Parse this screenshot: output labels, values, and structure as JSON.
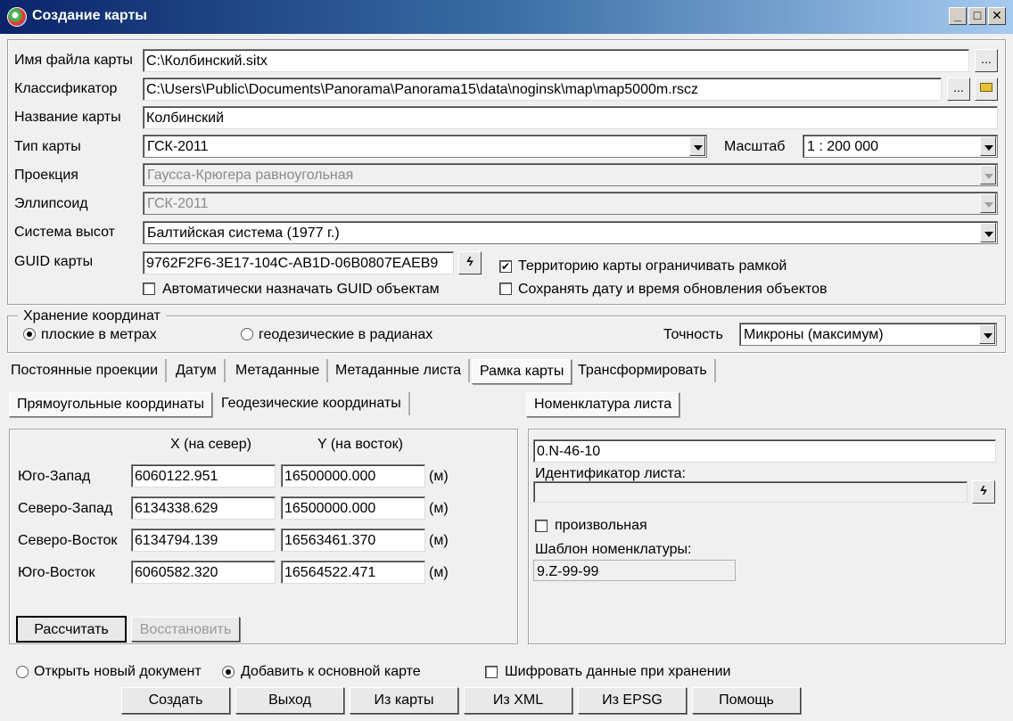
{
  "window": {
    "title": "Создание карты",
    "buttons": [
      "_",
      "□",
      "✕"
    ]
  },
  "form": {
    "file_label": "Имя файла карты",
    "file_value": "C:\\Колбинский.sitx",
    "classifier_label": "Классификатор",
    "classifier_value": "C:\\Users\\Public\\Documents\\Panorama\\Panorama15\\data\\noginsk\\map\\map5000m.rscz",
    "name_label": "Название карты",
    "name_value": "Колбинский",
    "type_label": "Тип карты",
    "type_value": "ГСК-2011",
    "scale_label": "Масштаб",
    "scale_value": "1 : 200 000",
    "projection_label": "Проекция",
    "projection_value": "Гаусса-Крюгера равноугольная",
    "ellipsoid_label": "Эллипсоид",
    "ellipsoid_value": "ГСК-2011",
    "height_label": "Система высот",
    "height_value": "Балтийская система (1977 г.)",
    "guid_label": "GUID карты",
    "guid_value": "9762F2F6-3E17-104C-AB1D-06B0807EAEB9",
    "browse": "...",
    "frame_check": {
      "label": "Территорию карты ограничивать рамкой",
      "checked": true
    },
    "guid_auto_check": {
      "label": "Автоматически назначать GUID объектам",
      "checked": false
    },
    "save_date_check": {
      "label": "Сохранять дату и время обновления объектов",
      "checked": false
    }
  },
  "coords": {
    "legend": "Хранение координат",
    "radio_plane": "плоские в метрах",
    "radio_geo": "геодезические в радианах",
    "accuracy_label": "Точность",
    "accuracy_value": "Микроны (максимум)"
  },
  "tabs": [
    "Постоянные проекции",
    "Датум",
    "Метаданные",
    "Метаданные листа",
    "Рамка карты",
    "Трансформировать"
  ],
  "subtabs": [
    "Прямоугольные координаты",
    "Геодезические координаты"
  ],
  "nomen_tab": "Номенклатура листа",
  "frame_table": {
    "col_x": "X (на север)",
    "col_y": "Y (на восток)",
    "unit": "(м)",
    "rows": [
      {
        "label": "Юго-Запад",
        "x": "6060122.951",
        "y": "16500000.000"
      },
      {
        "label": "Северо-Запад",
        "x": "6134338.629",
        "y": "16500000.000"
      },
      {
        "label": "Северо-Восток",
        "x": "6134794.139",
        "y": "16563461.370"
      },
      {
        "label": "Юго-Восток",
        "x": "6060582.320",
        "y": "16564522.471"
      }
    ],
    "calc_button": "Рассчитать",
    "restore_button": "Восстановить"
  },
  "nomen": {
    "value": "0.N-46-10",
    "id_label": "Идентификатор листа:",
    "id_value": "",
    "arbitrary_label": "произвольная",
    "template_label": "Шаблон номенклатуры:",
    "template_value": "9.Z-99-99"
  },
  "bottom": {
    "radio_new": "Открыть новый документ",
    "radio_add": "Добавить к основной карте",
    "encrypt": "Шифровать данные при хранении",
    "buttons": [
      "Создать",
      "Выход",
      "Из карты",
      "Из XML",
      "Из EPSG",
      "Помощь"
    ]
  }
}
